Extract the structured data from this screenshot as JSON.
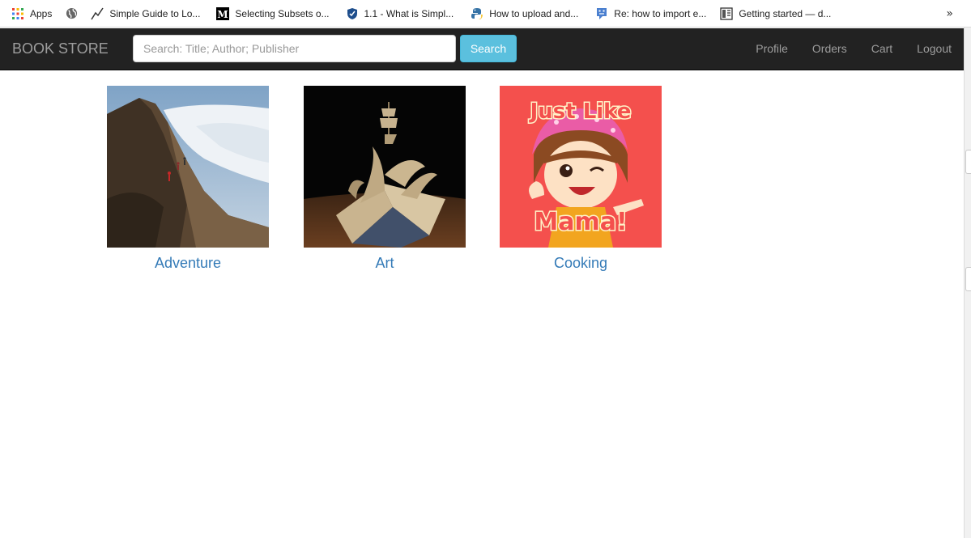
{
  "bookmarks": [
    {
      "label": "Apps",
      "icon": "apps-grid-icon"
    },
    {
      "label": "",
      "icon": "globe-icon"
    },
    {
      "label": "Simple Guide to Lo...",
      "icon": "trend-line-icon"
    },
    {
      "label": "Selecting Subsets o...",
      "icon": "medium-m-icon"
    },
    {
      "label": "1.1 - What is Simpl...",
      "icon": "shield-icon"
    },
    {
      "label": "How to upload and...",
      "icon": "python-icon"
    },
    {
      "label": "Re: how to import e...",
      "icon": "forum-icon"
    },
    {
      "label": "Getting started — d...",
      "icon": "docs-icon"
    }
  ],
  "bookmarks_overflow": "»",
  "navbar": {
    "brand": "BOOK STORE",
    "search_placeholder": "Search: Title; Author; Publisher",
    "search_button": "Search",
    "links": [
      "Profile",
      "Orders",
      "Cart",
      "Logout"
    ]
  },
  "categories": [
    {
      "label": "Adventure",
      "image": "mountain-ridge-photo"
    },
    {
      "label": "Art",
      "image": "book-sculpture-ship-photo"
    },
    {
      "label": "Cooking",
      "image": "just-like-mama-cartoon",
      "image_text": [
        "Just Like",
        "Mama!"
      ]
    }
  ]
}
